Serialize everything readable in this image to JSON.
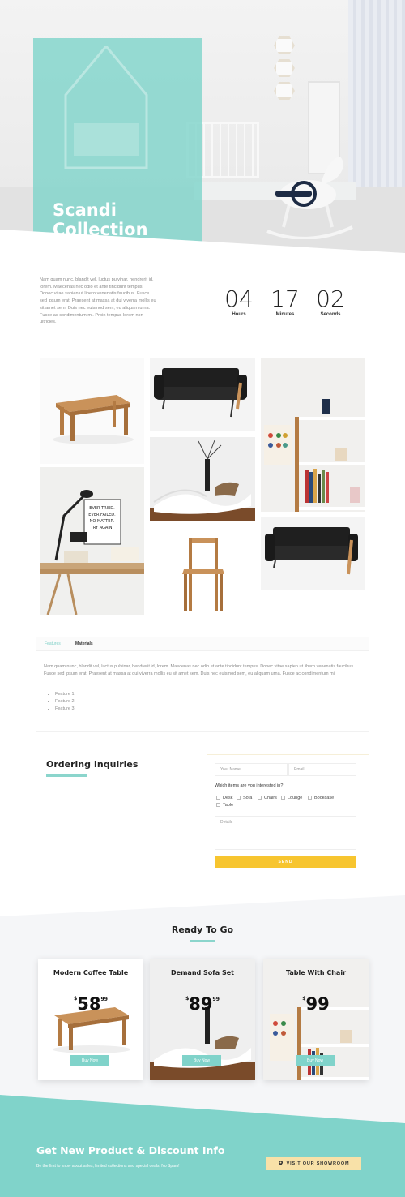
{
  "hero": {
    "title_line1": "Scandi",
    "title_line2": "Collection"
  },
  "intro": {
    "text": "Nam quam nunc, blandit vel, luctus pulvinar, hendrerit id, lorem. Maecenas nec odio et ante tincidunt tempus. Donec vitae sapien ut libero venenatis faucibus. Fusce sed ipsum erat. Praesent at massa at dui viverra mollis eu sit amet sem. Duis nec euismod sem, eu aliquam urna. Fusce ac condimentum mi. Proin tempus lorem non ultricies."
  },
  "countdown": {
    "hours": "04",
    "hours_label": "Hours",
    "minutes": "17",
    "minutes_label": "Minutes",
    "seconds": "02",
    "seconds_label": "Seconds"
  },
  "tabs": {
    "items": [
      {
        "label": "Features"
      },
      {
        "label": "Materials"
      }
    ],
    "content": "Nam quam nunc, blandit vel, luctus pulvinar, hendrerit id, lorem. Maecenas nec odio et ante tincidunt tempus. Donec vitae sapien ut libero venenatis faucibus. Fusce sed ipsum erat. Praesent at massa at dui viverra mollis eu sit amet sem. Duis nec euismod sem, eu aliquam urna. Fusce ac condimentum mi.",
    "features": [
      "Feature 1",
      "Feature 2",
      "Feature 3"
    ]
  },
  "order": {
    "title": "Ordering Inquiries",
    "name_placeholder": "Your Name",
    "email_placeholder": "Email",
    "question": "Which items are you interested in?",
    "options": [
      "Desk",
      "Sofa",
      "Chairs",
      "Lounge",
      "Bookcase",
      "Table"
    ],
    "details_placeholder": "Details",
    "send_label": "SEND"
  },
  "ready": {
    "title": "Ready To Go",
    "cards": [
      {
        "title": "Modern Coffee Table",
        "currency": "$",
        "price_main": "58",
        "price_cents": "99",
        "button": "Buy Now"
      },
      {
        "title": "Demand Sofa Set",
        "currency": "$",
        "price_main": "89",
        "price_cents": "99",
        "button": "Buy Now"
      },
      {
        "title": "Table With Chair",
        "currency": "$",
        "price_main": "99",
        "price_cents": "",
        "button": "Buy Now"
      }
    ]
  },
  "footer": {
    "title": "Get New Product & Discount Info",
    "subtitle": "Be the first to know about sales, limited collections and special deals. No Spam!",
    "button": "VISIT OUR SHOWROOM"
  },
  "colors": {
    "teal": "#80d3ca",
    "yellow": "#f7c52f",
    "cream": "#f8e1a8",
    "section_gray": "#f5f6f8"
  },
  "icons": {
    "showroom_button": "map-pin-icon"
  }
}
